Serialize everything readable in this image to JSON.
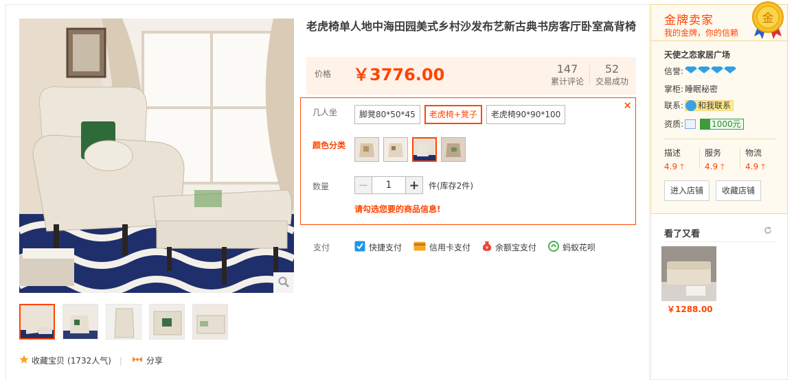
{
  "product": {
    "title": "老虎椅单人地中海田园美式乡村沙发布艺新古典书房客厅卧室高背椅",
    "price_label": "价格",
    "currency": "￥",
    "price": "3776.00",
    "reviews_count": "147",
    "reviews_label": "累计评论",
    "trades_count": "52",
    "trades_label": "交易成功"
  },
  "sku": {
    "close": "✕",
    "seat_label": "几人坐",
    "seat_options": [
      "脚凳80*50*45",
      "老虎椅+凳子",
      "老虎椅90*90*100"
    ],
    "seat_selected": 1,
    "color_label": "颜色分类",
    "color_selected": 2,
    "qty_label": "数量",
    "qty_minus": "−",
    "qty_value": "1",
    "qty_plus": "+",
    "qty_unit": "件(库存2件)",
    "warning": "请勾选您要的商品信息!"
  },
  "payment": {
    "label": "支付",
    "methods": [
      {
        "label": "快捷支付",
        "icon": "quick-pay-icon"
      },
      {
        "label": "信用卡支付",
        "icon": "credit-card-icon"
      },
      {
        "label": "余额宝支付",
        "icon": "yuebao-icon"
      },
      {
        "label": "蚂蚁花呗",
        "icon": "huabei-icon"
      }
    ]
  },
  "gallery": {
    "active_thumb": 0,
    "zoom_icon": "zoom-icon"
  },
  "actions": {
    "favorite": "收藏宝贝",
    "favorite_count": "(1732人气)",
    "share": "分享"
  },
  "seller": {
    "badge_title": "金牌卖家",
    "badge_sub": "我的金牌，你的信赖",
    "medal_char": "金",
    "shop_name": "天使之恋家居广场",
    "credit_label": "信誉:",
    "keeper_label": "掌柜:",
    "keeper_name": "睡眠秘密",
    "contact_label": "联系:",
    "contact_button": "和我联系",
    "qualification_label": "资质:",
    "deposit": "1000元",
    "scores": [
      {
        "label": "描述",
        "value": "4.9"
      },
      {
        "label": "服务",
        "value": "4.9"
      },
      {
        "label": "物流",
        "value": "4.9"
      }
    ],
    "enter_shop": "进入店铺",
    "favorite_shop": "收藏店铺"
  },
  "also_viewed": {
    "title": "看了又看",
    "price": "￥1288.00"
  },
  "colors": {
    "accent": "#ff4400",
    "price_bg": "#fff2e8",
    "gold_border": "#f2d78d",
    "diamond": "#2f9fe8"
  }
}
